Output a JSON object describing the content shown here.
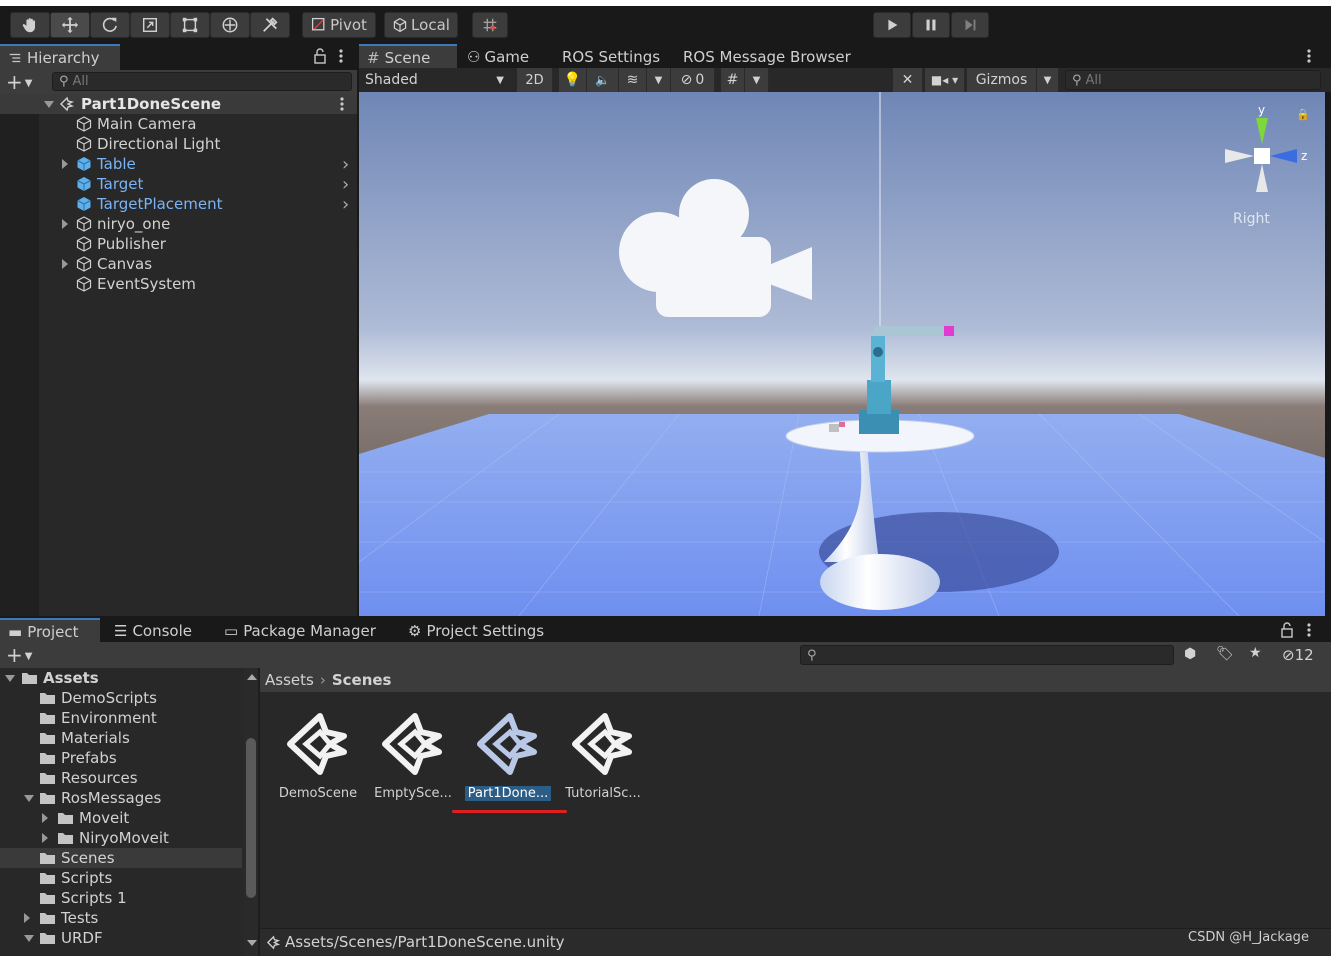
{
  "toolbar": {
    "tools": [
      "hand-tool",
      "move-tool",
      "rotate-tool",
      "scale-tool",
      "rect-tool",
      "transform-tool",
      "custom-tool"
    ],
    "pivot_label": "Pivot",
    "local_label": "Local",
    "grid_snap": "grid-snap",
    "play": "play",
    "pause": "pause",
    "step": "step"
  },
  "hierarchy": {
    "tab_label": "Hierarchy",
    "search_placeholder": "All",
    "scene_name": "Part1DoneScene",
    "items": [
      {
        "label": "Main Camera",
        "type": "gameobject"
      },
      {
        "label": "Directional Light",
        "type": "gameobject"
      },
      {
        "label": "Table",
        "type": "prefab"
      },
      {
        "label": "Target",
        "type": "prefab"
      },
      {
        "label": "TargetPlacement",
        "type": "prefab"
      },
      {
        "label": "niryo_one",
        "type": "gameobject"
      },
      {
        "label": "Publisher",
        "type": "gameobject"
      },
      {
        "label": "Canvas",
        "type": "gameobject"
      },
      {
        "label": "EventSystem",
        "type": "gameobject"
      }
    ]
  },
  "scene_view": {
    "tabs": [
      "Scene",
      "Game",
      "ROS Settings",
      "ROS Message Browser"
    ],
    "shading_mode": "Shaded",
    "mode_2d": "2D",
    "hidden_count": "0",
    "gizmos_label": "Gizmos",
    "search_placeholder": "All",
    "gizmo_axis_y": "y",
    "gizmo_axis_z": "z",
    "view_label": "Right"
  },
  "project": {
    "tabs": [
      "Project",
      "Console",
      "Package Manager",
      "Project Settings"
    ],
    "hidden_count": "12",
    "tree_root": "Assets",
    "tree": [
      {
        "label": "DemoScripts",
        "depth": 1
      },
      {
        "label": "Environment",
        "depth": 1
      },
      {
        "label": "Materials",
        "depth": 1
      },
      {
        "label": "Prefabs",
        "depth": 1
      },
      {
        "label": "Resources",
        "depth": 1
      },
      {
        "label": "RosMessages",
        "depth": 1
      },
      {
        "label": "Moveit",
        "depth": 2
      },
      {
        "label": "NiryoMoveit",
        "depth": 2
      },
      {
        "label": "Scenes",
        "depth": 1
      },
      {
        "label": "Scripts",
        "depth": 1
      },
      {
        "label": "Scripts 1",
        "depth": 1
      },
      {
        "label": "Tests",
        "depth": 1
      },
      {
        "label": "URDF",
        "depth": 1
      }
    ],
    "breadcrumb": [
      "Assets",
      "Scenes"
    ],
    "assets": [
      "DemoScene",
      "EmptySce...",
      "Part1Done...",
      "TutorialSc..."
    ],
    "selected_asset": "Part1Done...",
    "status_path": "Assets/Scenes/Part1DoneScene.unity"
  },
  "watermark": "CSDN @H_Jackage",
  "colors": {
    "accent": "#3a79bb",
    "prefab_blue": "#7ab4f5",
    "annotation_red": "#e02020"
  }
}
